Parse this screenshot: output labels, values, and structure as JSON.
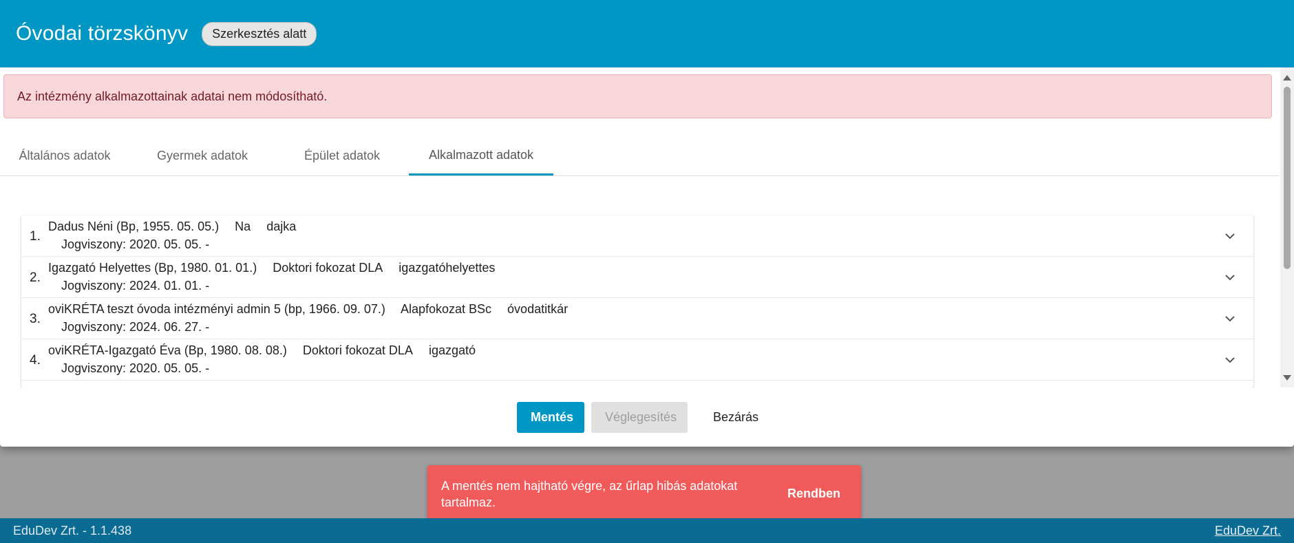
{
  "header": {
    "title": "Óvodai törzskönyv",
    "status_badge": "Szerkesztés alatt"
  },
  "alert": {
    "text": "Az intézmény alkalmazottainak adatai nem módosítható."
  },
  "tabs": [
    {
      "label": "Általános adatok",
      "active": false
    },
    {
      "label": "Gyermek adatok",
      "active": false
    },
    {
      "label": "Épület adatok",
      "active": false
    },
    {
      "label": "Alkalmazott adatok",
      "active": true
    }
  ],
  "employees": [
    {
      "num": "1.",
      "name": "Dadus Néni (Bp, 1955. 05. 05.)",
      "degree": "Na",
      "role": "dajka",
      "employment": "Jogviszony:  2020. 05. 05.  -"
    },
    {
      "num": "2.",
      "name": "Igazgató Helyettes (Bp, 1980. 01. 01.)",
      "degree": "Doktori fokozat DLA",
      "role": "igazgatóhelyettes",
      "employment": "Jogviszony:  2024. 01. 01.  -"
    },
    {
      "num": "3.",
      "name": "oviKRÉTA teszt óvoda intézményi admin 5 (bp, 1966. 09. 07.)",
      "degree": "Alapfokozat BSc",
      "role": "óvodatitkár",
      "employment": "Jogviszony:  2024. 06. 27.  -"
    },
    {
      "num": "4.",
      "name": "oviKRÉTA-Igazgató Éva (Bp, 1980. 08. 08.)",
      "degree": "Doktori fokozat DLA",
      "role": "igazgató",
      "employment": "Jogviszony:  2020. 05. 05.  -"
    }
  ],
  "actions": {
    "save": "Mentés",
    "finalize": "Véglegesítés",
    "close": "Bezárás"
  },
  "toast": {
    "message": "A mentés nem hajtható végre, az űrlap hibás adatokat tartalmaz.",
    "action": "Rendben"
  },
  "footer": {
    "left": "EduDev Zrt. - 1.1.438",
    "right_link": "EduDev Zrt."
  },
  "colors": {
    "primary": "#0097c4",
    "alert_bg": "#f8d7da",
    "toast_bg": "#f05a5a",
    "footer_bg": "#0a6c93"
  }
}
